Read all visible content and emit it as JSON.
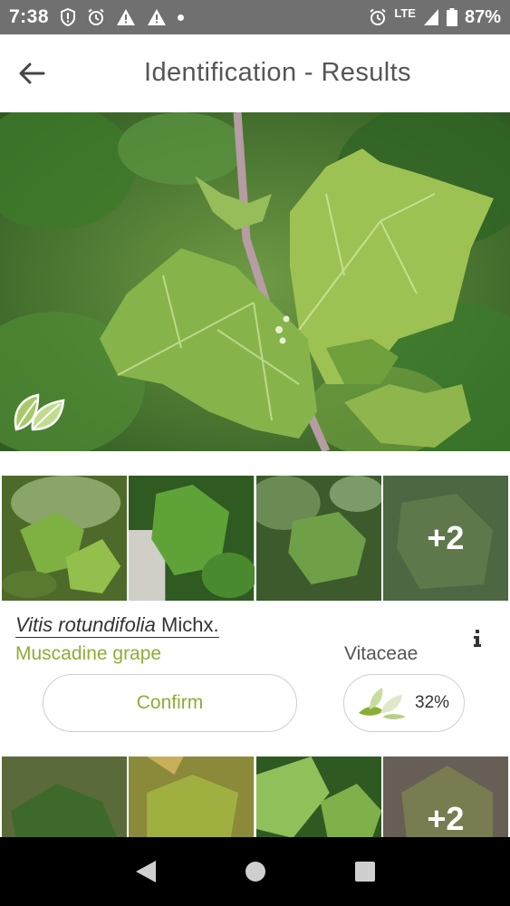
{
  "status_bar": {
    "time": "7:38",
    "network": "LTE",
    "battery": "87%",
    "icons": [
      "shield-alert-icon",
      "alarm-icon",
      "warning-icon",
      "warning-icon",
      "dot-icon",
      "alarm-icon",
      "signal-icon",
      "battery-icon"
    ]
  },
  "header": {
    "title": "Identification - Results",
    "back_icon": "arrow-left-icon"
  },
  "hero": {
    "description_icon": "leaf-organ-icon"
  },
  "result": {
    "scientific_name": "Vitis rotundifolia",
    "author": "Michx.",
    "common_name": "Muscadine grape",
    "family": "Vitaceae",
    "confirm_label": "Confirm",
    "score": "32%",
    "score_fraction": 0.32,
    "info_icon": "info-icon"
  },
  "thumbnails_primary": {
    "more_label": "+2"
  },
  "thumbnails_secondary": {
    "more_label": "+2"
  },
  "colors": {
    "accent_green": "#8aae35",
    "status_bar": "#707070",
    "nav_bar": "#000000"
  },
  "nav": {
    "back_icon": "triangle-back-icon",
    "home_icon": "circle-home-icon",
    "recents_icon": "square-recents-icon"
  }
}
